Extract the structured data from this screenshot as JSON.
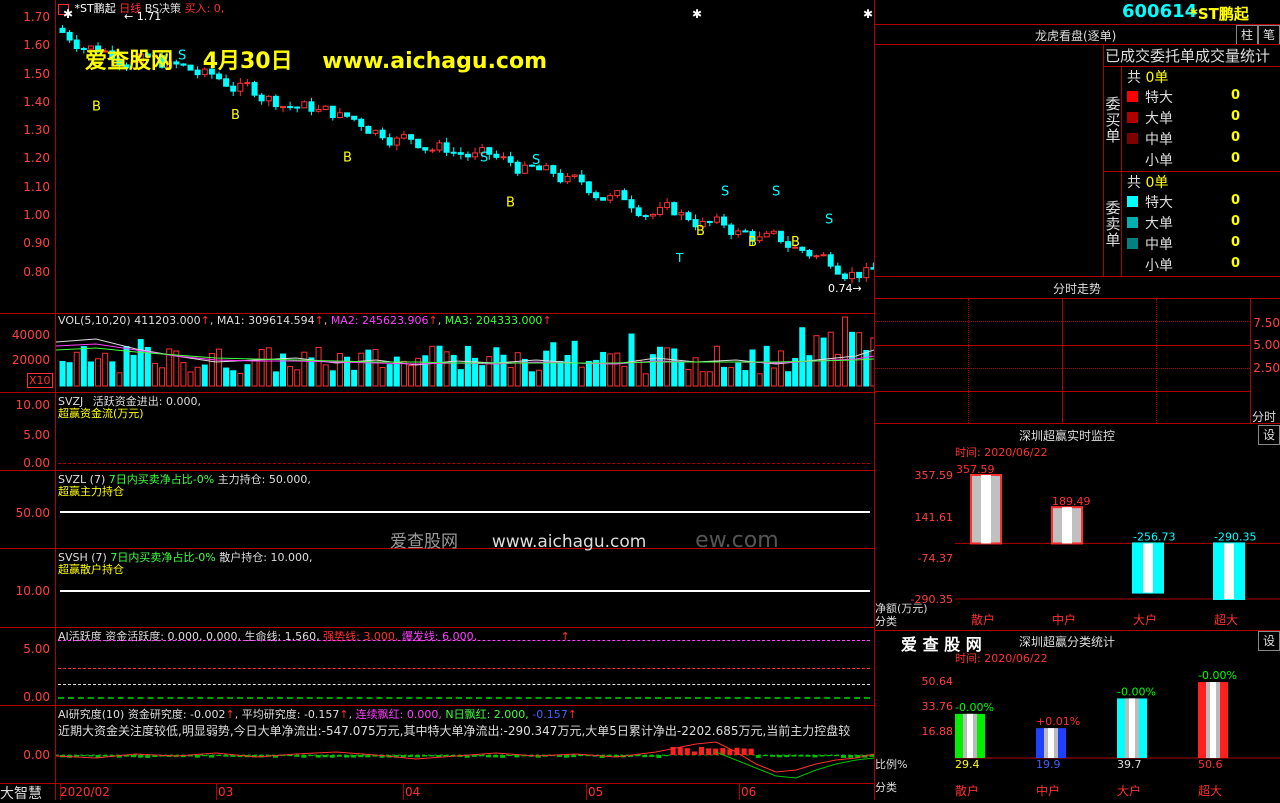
{
  "watermark": {
    "brand": "爱查股网",
    "date": "4月30日",
    "url": "www.aichagu.com",
    "center_brand": "爱查股网",
    "center_url": "www.aichagu.com",
    "center_suffix": "ew.com"
  },
  "kline": {
    "stock_name": "*ST鹏起",
    "period": "日线",
    "indicator": "BS决策",
    "signal": "买入: 0,",
    "high_marker": "1.71",
    "low_marker": "0.74",
    "yaxis": [
      "1.70",
      "1.60",
      "1.50",
      "1.40",
      "1.30",
      "1.20",
      "1.10",
      "1.00",
      "0.90",
      "0.80"
    ],
    "buy_label": "B",
    "sell_label": "S",
    "t_label": "T"
  },
  "vol": {
    "title": "VOL(5,10,20)",
    "value": "411203.000",
    "ma1": "MA1: 309614.594",
    "ma2": "MA2: 245623.906",
    "ma3": "MA3: 204333.000",
    "yaxis": [
      "40000",
      "20000"
    ],
    "unit": "X10"
  },
  "svzj": {
    "title": "SVZJ",
    "text": "活跃资金进出: 0.000,",
    "subtitle": "超赢资金流(万元)",
    "yaxis": [
      "10.00",
      "5.00",
      "0.00"
    ]
  },
  "svzl": {
    "title": "SVZL (7)",
    "ratio": "7日内买卖净占比-0%",
    "holding": "主力持仓: 50.000,",
    "subtitle": "超赢主力持仓",
    "yaxis": "50.00"
  },
  "svsh": {
    "title": "SVSH (7)",
    "ratio": "7日内买卖净占比-0%",
    "holding": "散户持仓: 10.000,",
    "subtitle": "超赢散户持仓",
    "yaxis": "10.00"
  },
  "ai_active": {
    "title": "AI活跃度",
    "text": "资金活跃度: 0.000, 0.000,",
    "life": "生命线: 1.560,",
    "strong": "强势线: 3.000,",
    "burst": "爆发线: 6.000,",
    "yaxis": [
      "5.00",
      "0.00"
    ]
  },
  "ai_research": {
    "title": "AI研究度(10)",
    "degree": "资金研究度: -0.002",
    "avg": "平均研究度: -0.157",
    "cont_red": "连续飘红: 0.000,",
    "n_red": "N日飘红: 2.000,",
    "tail": "-0.157",
    "sentence": "近期大资金关注度较低,明显弱势,今日大单净流出:-547.075万元,其中特大单净流出:-290.347万元,大单5日累计净出-2202.685万元,当前主力控盘较",
    "yaxis": "0.00"
  },
  "bottom": {
    "brand": "大智慧",
    "dates": [
      "2020/02",
      "03",
      "04",
      "05",
      "06"
    ]
  },
  "header": {
    "code": "600614",
    "name": "*ST鹏起"
  },
  "lhb": {
    "title": "龙虎看盘(逐单)",
    "btn1": "柱",
    "btn2": "笔",
    "stats_title": "已成交委托单成交量统计",
    "buy_side": "委买单",
    "sell_side": "委卖单",
    "buy": {
      "total_label": "共",
      "total": "0单",
      "rows": [
        {
          "label": "特大",
          "value": "0"
        },
        {
          "label": "大单",
          "value": "0"
        },
        {
          "label": "中单",
          "value": "0"
        },
        {
          "label": "小单",
          "value": "0"
        }
      ]
    },
    "sell": {
      "total_label": "共",
      "total": "0单",
      "rows": [
        {
          "label": "特大",
          "value": "0"
        },
        {
          "label": "大单",
          "value": "0"
        },
        {
          "label": "中单",
          "value": "0"
        },
        {
          "label": "小单",
          "value": "0"
        }
      ]
    },
    "colors": {
      "buy": [
        "#ff0000",
        "#b00000",
        "#800000"
      ],
      "sell": [
        "#00ffff",
        "#00b0b0",
        "#008080"
      ]
    }
  },
  "fenshi": {
    "title": "分时走势",
    "yaxis": [
      "7.50",
      "5.00",
      "2.50"
    ],
    "label": "分时"
  },
  "monitor": {
    "title": "深圳超赢实时监控",
    "btn": "设",
    "time": "时间: 2020/06/22",
    "yaxis": [
      "357.59",
      "141.61",
      "-74.37",
      "-290.35"
    ],
    "ylabel": "净额(万元)",
    "xlabel": "分类",
    "categories": [
      "散户",
      "中户",
      "大户",
      "超大"
    ],
    "values": [
      357.59,
      189.49,
      -256.73,
      -290.35
    ],
    "value_labels": [
      "357.59",
      "189.49",
      "-256.73",
      "-290.35"
    ]
  },
  "classify": {
    "brand": "爱 查 股 网",
    "title": "深圳超赢分类统计",
    "btn": "设",
    "time": "时间: 2020/06/22",
    "yaxis": [
      "50.64",
      "33.76",
      "16.88"
    ],
    "ylabel": "比例%",
    "xlabel": "分类",
    "categories": [
      "散户",
      "中户",
      "大户",
      "超大"
    ],
    "values": [
      29.4,
      19.9,
      39.7,
      50.6
    ],
    "value_labels": [
      "29.4",
      "19.9",
      "39.7",
      "50.6"
    ],
    "change_labels": [
      "-0.00%",
      "+0.01%",
      "-0.00%",
      "-0.00%"
    ],
    "colors": [
      "#00ee00",
      "#2040ff",
      "#00ffff",
      "#ff2020"
    ]
  }
}
